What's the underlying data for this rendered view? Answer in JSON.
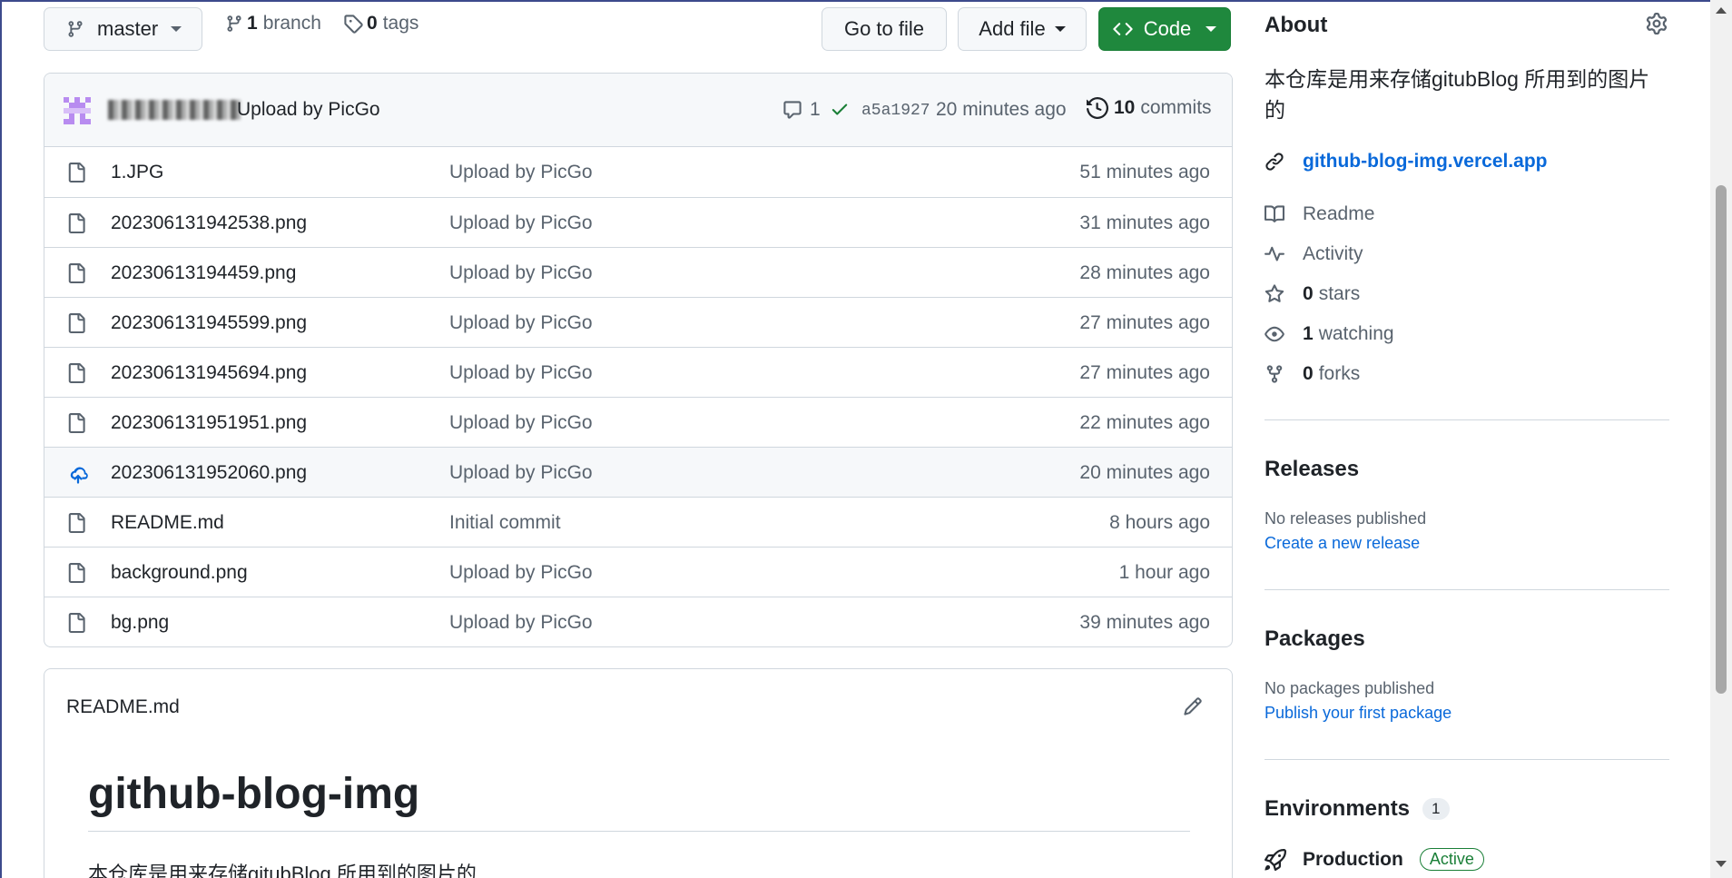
{
  "branch_selector": {
    "label": "master"
  },
  "branches": {
    "count": "1",
    "label": "branch"
  },
  "tags": {
    "count": "0",
    "label": "tags"
  },
  "actions": {
    "go_to_file": "Go to file",
    "add_file": "Add file",
    "code": "Code"
  },
  "latest_commit": {
    "message": "Upload by PicGo",
    "comments": "1",
    "sha": "a5a1927",
    "time": "20 minutes ago",
    "commits_count": "10",
    "commits_label": "commits"
  },
  "files": [
    {
      "name": "1.JPG",
      "message": "Upload by PicGo",
      "age": "51 minutes ago",
      "icon": "file-icon"
    },
    {
      "name": "202306131942538.png",
      "message": "Upload by PicGo",
      "age": "31 minutes ago",
      "icon": "file-icon"
    },
    {
      "name": "20230613194459.png",
      "message": "Upload by PicGo",
      "age": "28 minutes ago",
      "icon": "file-icon"
    },
    {
      "name": "202306131945599.png",
      "message": "Upload by PicGo",
      "age": "27 minutes ago",
      "icon": "file-icon"
    },
    {
      "name": "202306131945694.png",
      "message": "Upload by PicGo",
      "age": "27 minutes ago",
      "icon": "file-icon"
    },
    {
      "name": "202306131951951.png",
      "message": "Upload by PicGo",
      "age": "22 minutes ago",
      "icon": "file-icon"
    },
    {
      "name": "202306131952060.png",
      "message": "Upload by PicGo",
      "age": "20 minutes ago",
      "icon": "cloud-upload-icon"
    },
    {
      "name": "README.md",
      "message": "Initial commit",
      "age": "8 hours ago",
      "icon": "file-icon"
    },
    {
      "name": "background.png",
      "message": "Upload by PicGo",
      "age": "1 hour ago",
      "icon": "file-icon"
    },
    {
      "name": "bg.png",
      "message": "Upload by PicGo",
      "age": "39 minutes ago",
      "icon": "file-icon"
    }
  ],
  "readme": {
    "filename": "README.md",
    "heading": "github-blog-img",
    "body": "本仓库是用来存储gitubBlog 所用到的图片的"
  },
  "about": {
    "title": "About",
    "description": "本仓库是用来存储gitubBlog 所用到的图片的",
    "website": "github-blog-img.vercel.app",
    "readme": "Readme",
    "activity": "Activity",
    "stars_count": "0",
    "stars_label": "stars",
    "watching_count": "1",
    "watching_label": "watching",
    "forks_count": "0",
    "forks_label": "forks"
  },
  "releases": {
    "title": "Releases",
    "empty": "No releases published",
    "link": "Create a new release"
  },
  "packages": {
    "title": "Packages",
    "empty": "No packages published",
    "link": "Publish your first package"
  },
  "environments": {
    "title": "Environments",
    "count": "1",
    "production": "Production",
    "status": "Active"
  },
  "colors": {
    "accent_blue": "#0969da",
    "success_green": "#1a7f37",
    "button_green": "#1f883d",
    "muted": "#59636e",
    "border": "#d0d7de"
  }
}
